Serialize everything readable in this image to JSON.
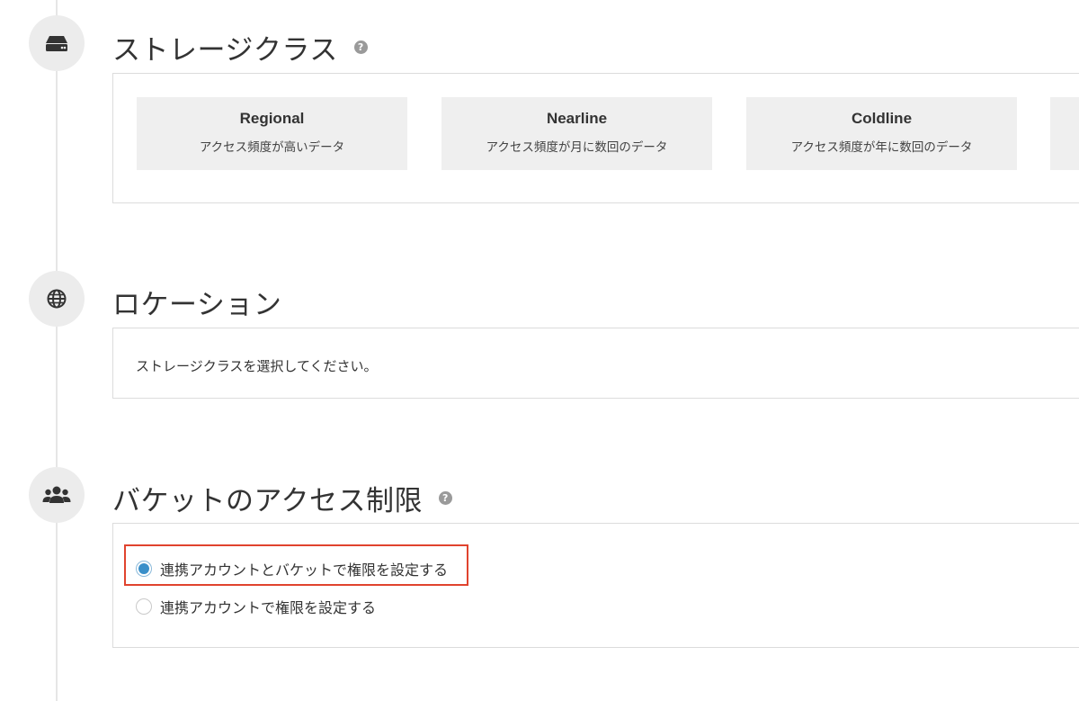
{
  "sections": {
    "storage_class": {
      "title": "ストレージクラス",
      "icon": "hard-drive-icon",
      "help_icon": "question-circle-icon",
      "help_glyph": "?",
      "options": [
        {
          "name": "Regional",
          "desc": "アクセス頻度が高いデータ"
        },
        {
          "name": "Nearline",
          "desc": "アクセス頻度が月に数回のデータ"
        },
        {
          "name": "Coldline",
          "desc": "アクセス頻度が年に数回のデータ"
        }
      ]
    },
    "location": {
      "title": "ロケーション",
      "icon": "globe-icon",
      "message": "ストレージクラスを選択してください。"
    },
    "bucket_access": {
      "title": "バケットのアクセス制限",
      "icon": "users-icon",
      "help_icon": "question-circle-icon",
      "help_glyph": "?",
      "options": [
        {
          "label": "連携アカウントとバケットで権限を設定する",
          "checked": true
        },
        {
          "label": "連携アカウントで権限を設定する",
          "checked": false
        }
      ]
    }
  },
  "colors": {
    "timeline": "#e6e6e6",
    "icon_bg": "#ececec",
    "card_bg": "#efefef",
    "radio_checked": "#3a8fc9",
    "highlight": "#e0432e"
  }
}
